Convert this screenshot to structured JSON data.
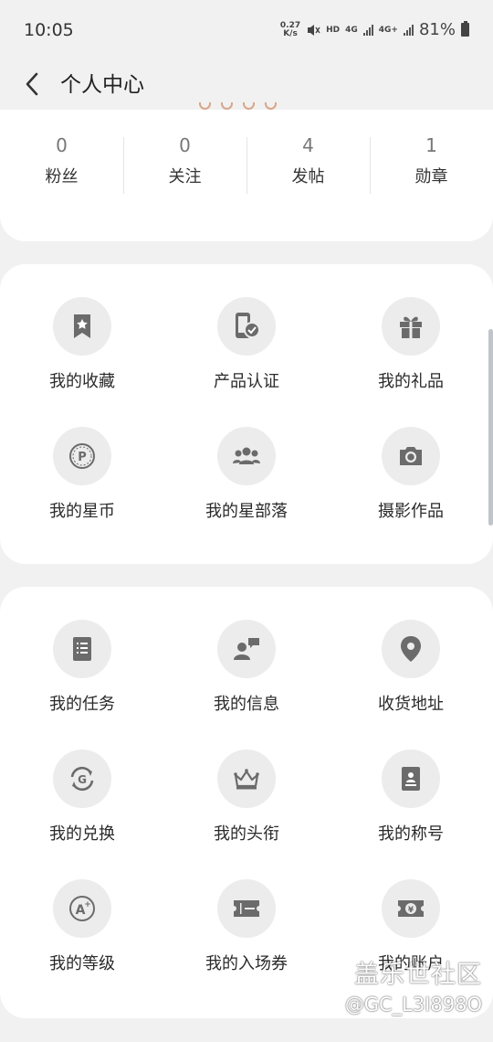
{
  "status_bar": {
    "time": "10:05",
    "net_speed_value": "0.27",
    "net_speed_unit": "K/s",
    "hd_label": "HD",
    "net1_label": "4G",
    "net2_label": "4G+",
    "battery_text": "81%"
  },
  "header": {
    "title": "个人中心",
    "back_icon": "chevron-left-icon"
  },
  "stats": [
    {
      "value": "0",
      "label": "粉丝"
    },
    {
      "value": "0",
      "label": "关注"
    },
    {
      "value": "4",
      "label": "发帖"
    },
    {
      "value": "1",
      "label": "勋章"
    }
  ],
  "grid_top": [
    {
      "label": "我的收藏",
      "icon": "bookmark-star-icon"
    },
    {
      "label": "产品认证",
      "icon": "phone-verified-icon"
    },
    {
      "label": "我的礼品",
      "icon": "gift-icon"
    },
    {
      "label": "我的星币",
      "icon": "coin-p-icon"
    },
    {
      "label": "我的星部落",
      "icon": "group-icon"
    },
    {
      "label": "摄影作品",
      "icon": "camera-icon"
    }
  ],
  "grid_bottom": [
    {
      "label": "我的任务",
      "icon": "task-list-icon"
    },
    {
      "label": "我的信息",
      "icon": "user-message-icon"
    },
    {
      "label": "收货地址",
      "icon": "location-pin-icon"
    },
    {
      "label": "我的兑换",
      "icon": "exchange-g-icon"
    },
    {
      "label": "我的头衔",
      "icon": "crown-icon"
    },
    {
      "label": "我的称号",
      "icon": "id-badge-icon"
    },
    {
      "label": "我的等级",
      "icon": "level-a-plus-icon"
    },
    {
      "label": "我的入场券",
      "icon": "ticket-icon"
    },
    {
      "label": "我的账户",
      "icon": "yen-wallet-icon"
    }
  ],
  "watermark": {
    "main": "盖乐世社区",
    "sub": "@GC_L3I898O"
  },
  "colors": {
    "background": "#f1f1f1",
    "card": "#ffffff",
    "icon_circle": "#ececec",
    "icon_fill": "#6b6b6b"
  }
}
